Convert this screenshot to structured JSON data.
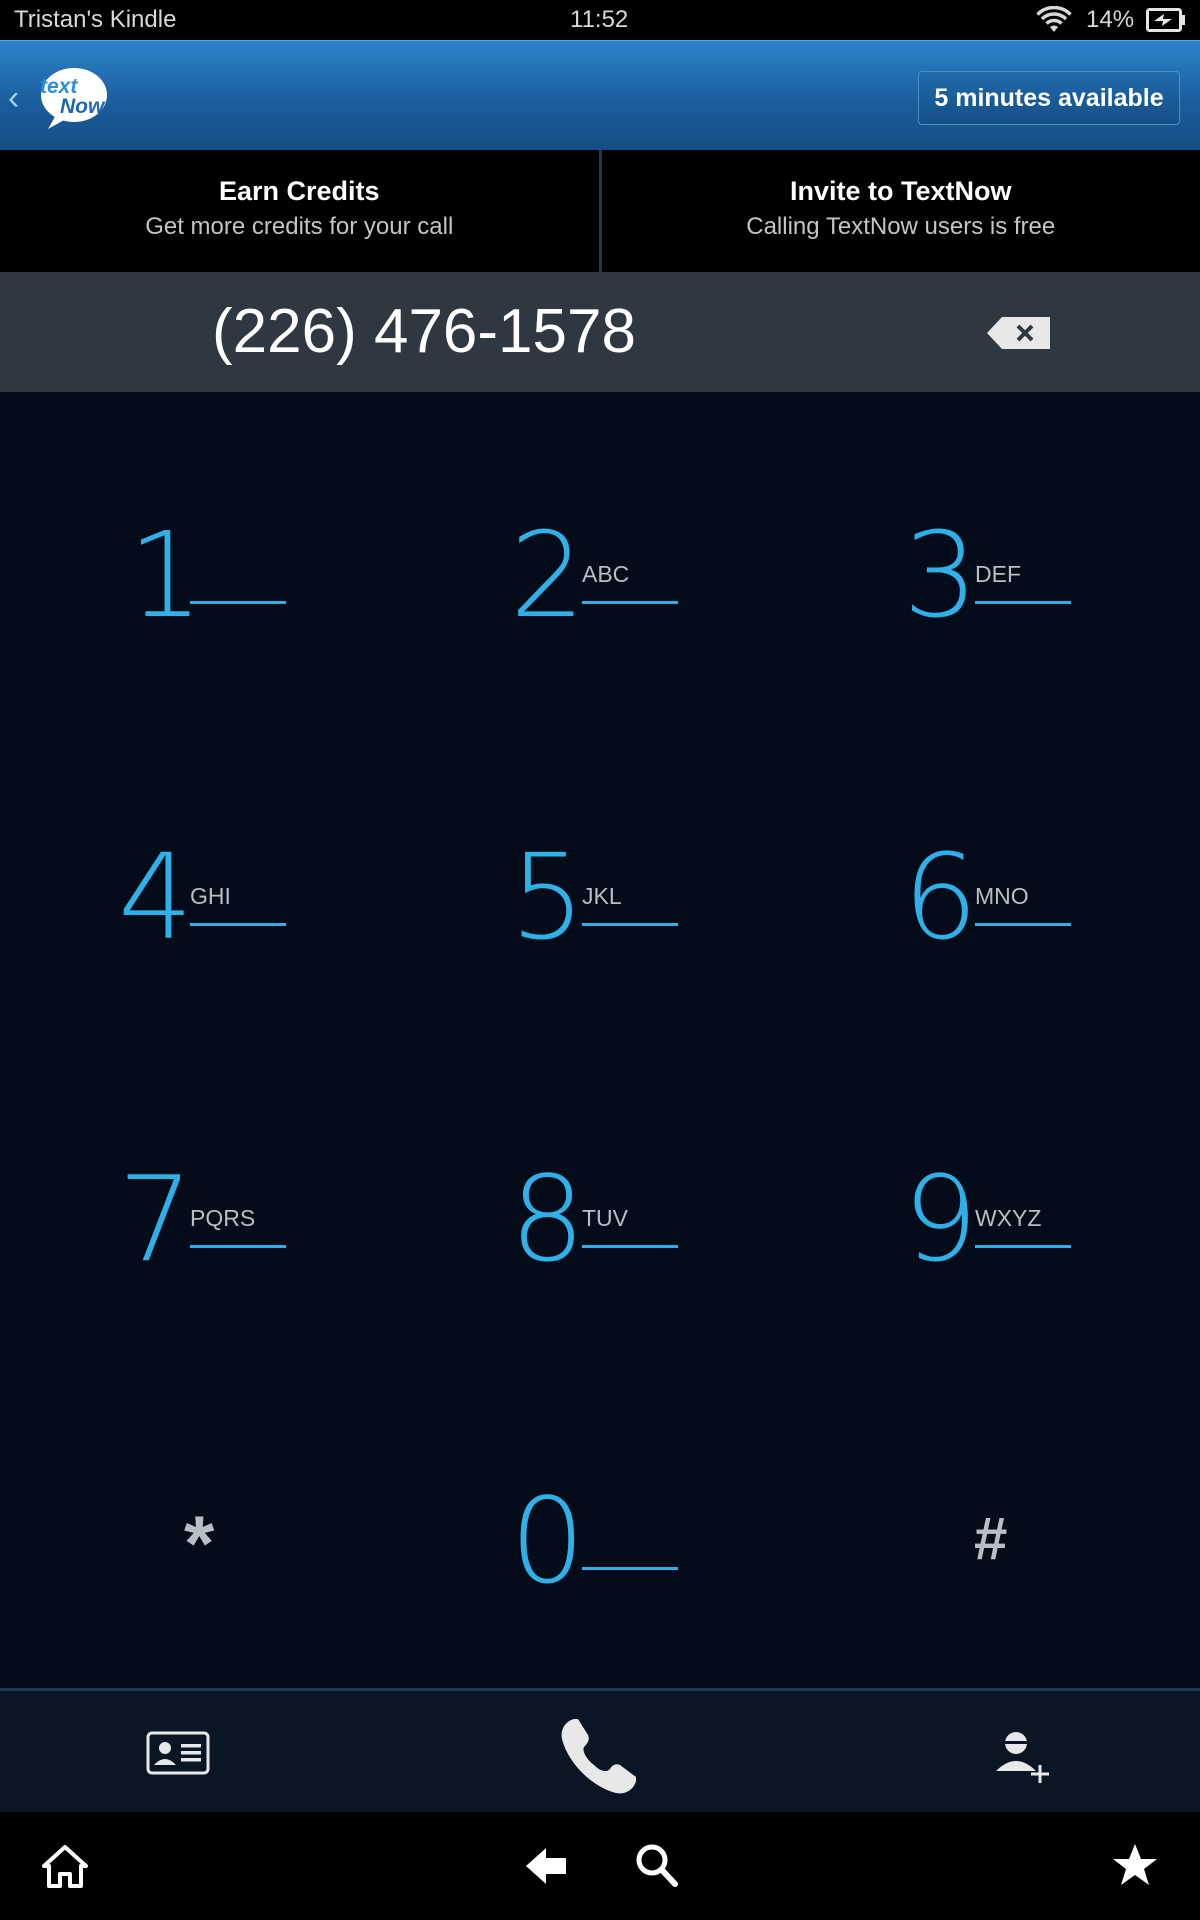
{
  "status_bar": {
    "device_name": "Tristan's Kindle",
    "time": "11:52",
    "battery_percent": "14%",
    "icons": [
      "wifi-icon",
      "battery-charging-icon"
    ]
  },
  "app_bar": {
    "logo_text": "textNow",
    "minutes_button": "5 minutes available",
    "accent_color": "#1b5e9e"
  },
  "promos": [
    {
      "title": "Earn Credits",
      "subtitle": "Get more credits for your call"
    },
    {
      "title": "Invite to TextNow",
      "subtitle": "Calling TextNow users is free"
    }
  ],
  "dialer": {
    "number": "(226) 476-1578",
    "keys": [
      {
        "digit": "1",
        "letters": ""
      },
      {
        "digit": "2",
        "letters": "ABC"
      },
      {
        "digit": "3",
        "letters": "DEF"
      },
      {
        "digit": "4",
        "letters": "GHI"
      },
      {
        "digit": "5",
        "letters": "JKL"
      },
      {
        "digit": "6",
        "letters": "MNO"
      },
      {
        "digit": "7",
        "letters": "PQRS"
      },
      {
        "digit": "8",
        "letters": "TUV"
      },
      {
        "digit": "9",
        "letters": "WXYZ"
      },
      {
        "digit": "0",
        "letters": ""
      }
    ],
    "star": "*",
    "hash": "#",
    "digit_color": "#2fb0e8"
  },
  "action_bar": {
    "icons": [
      "contact-card-icon",
      "call-phone-icon",
      "add-contact-icon"
    ]
  },
  "system_nav": {
    "icons": [
      "home-icon",
      "back-arrow-icon",
      "search-icon",
      "star-icon"
    ]
  }
}
